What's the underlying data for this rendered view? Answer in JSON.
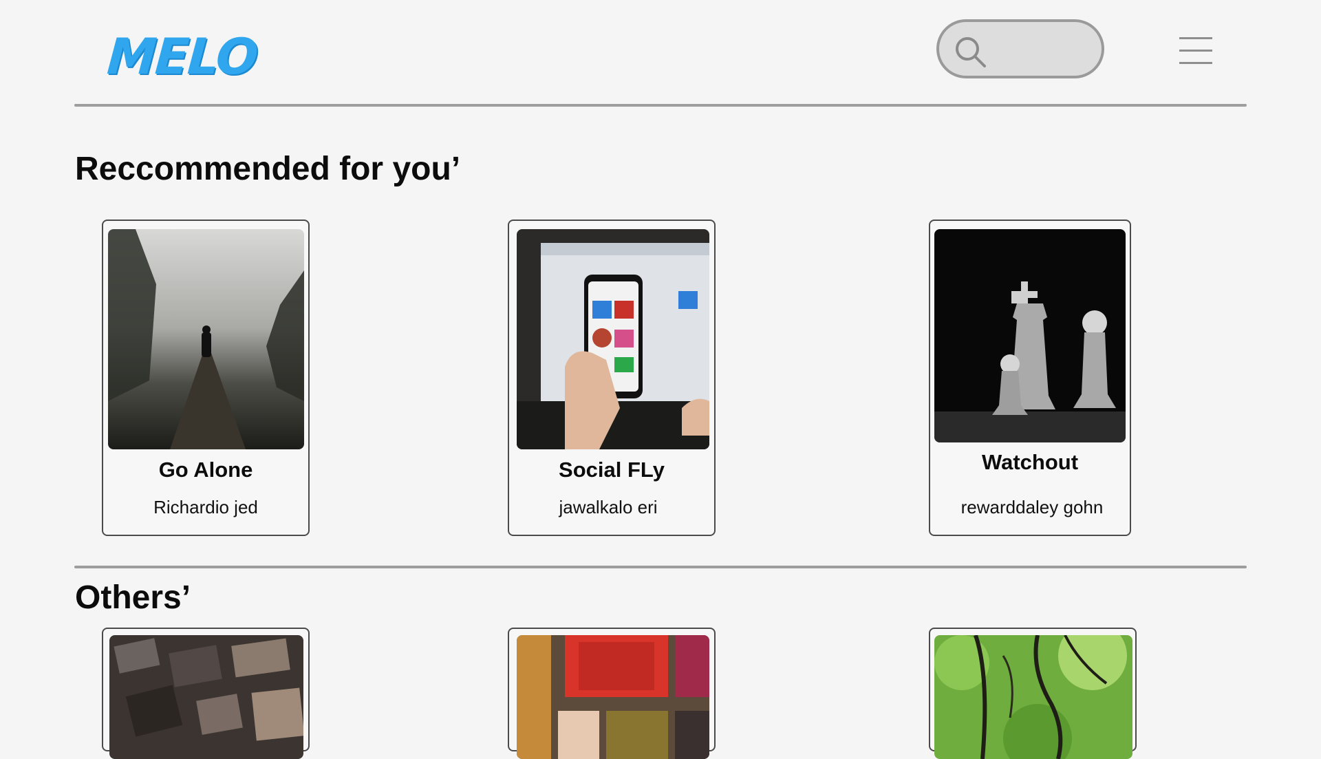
{
  "header": {
    "logo_text": "MELO",
    "search_placeholder": "",
    "search_icon": "search-icon",
    "menu_icon": "hamburger-menu-icon",
    "brand_color": "#2fa6ee"
  },
  "recommended": {
    "title": "Reccommended for you’",
    "cards": [
      {
        "title": "Go Alone",
        "author": "Richardio jed",
        "image": "foggy-forest-cyclist-image"
      },
      {
        "title": "Social FLy",
        "author": "jawalkalo eri",
        "image": "phone-laptop-image"
      },
      {
        "title": "Watchout",
        "author": "rewarddaley gohn",
        "image": "glass-chess-pieces-image"
      }
    ]
  },
  "others": {
    "title": "Others’",
    "cards": [
      {
        "image": "wooden-type-blocks-image"
      },
      {
        "image": "colorful-painted-door-image"
      },
      {
        "image": "green-tree-canopy-image"
      }
    ]
  }
}
